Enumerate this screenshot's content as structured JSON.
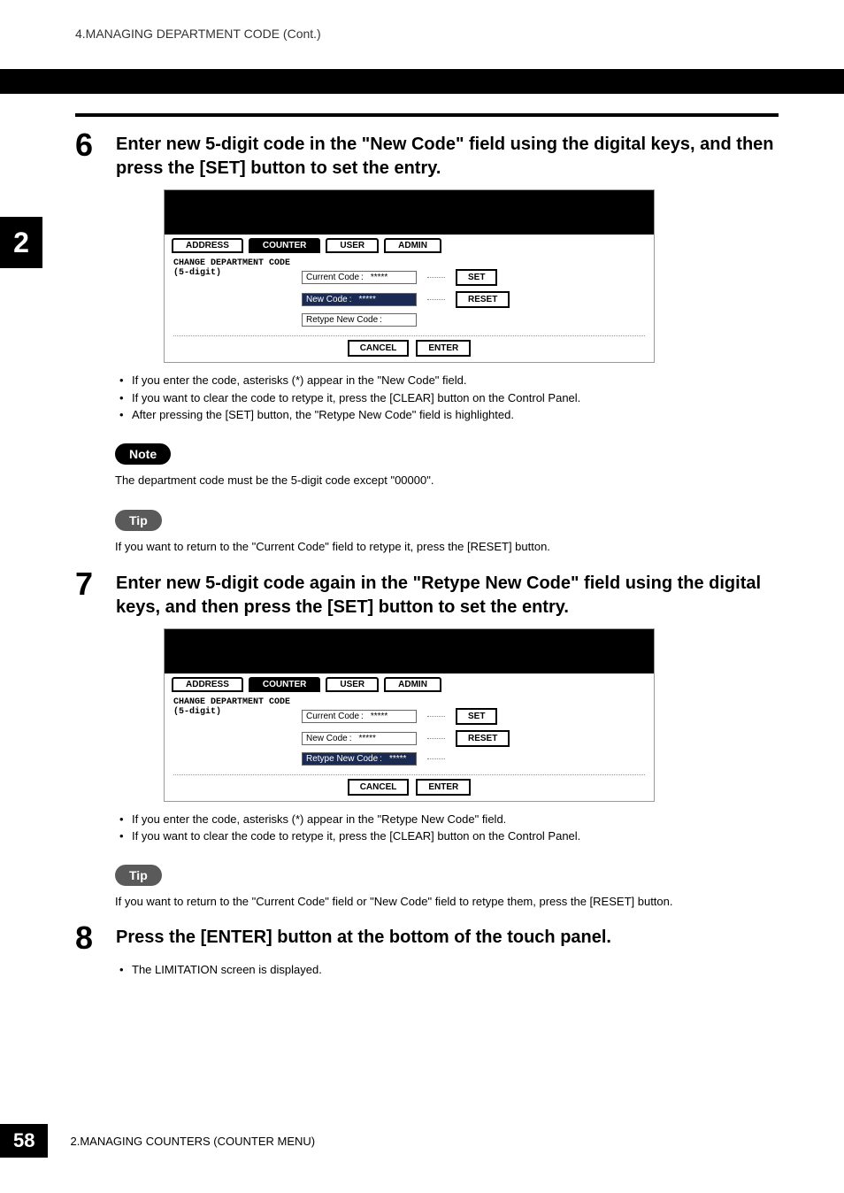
{
  "header": {
    "breadcrumb": "4.MANAGING DEPARTMENT CODE (Cont.)"
  },
  "chapterTab": "2",
  "step6": {
    "num": "6",
    "title": "Enter new 5-digit code in the \"New Code\" field using the digital keys, and then press the [SET] button to set the entry.",
    "bullets": [
      "If you enter the code, asterisks (*) appear in the \"New Code\" field.",
      "If you want to clear the code to retype it, press the [CLEAR] button on the Control Panel.",
      "After pressing the [SET] button, the \"Retype New Code\" field is highlighted."
    ]
  },
  "ui6": {
    "tabs": [
      "ADDRESS",
      "COUNTER",
      "USER",
      "ADMIN"
    ],
    "activeTab": 1,
    "title": "CHANGE DEPARTMENT CODE",
    "subtitle": "(5-digit)",
    "rows": {
      "current": {
        "label": "Current Code",
        "value": "*****",
        "btn": "SET"
      },
      "new": {
        "label": "New Code",
        "value": "*****",
        "btn": "RESET",
        "active": true
      },
      "retype": {
        "label": "Retype New Code",
        "value": "",
        "btn": null
      }
    },
    "bottom": {
      "cancel": "CANCEL",
      "enter": "ENTER"
    }
  },
  "note": {
    "label": "Note",
    "text": "The department code must be the 5-digit code except \"00000\"."
  },
  "tip6": {
    "label": "Tip",
    "text": "If you want to return to the \"Current Code\" field to retype it, press the [RESET] button."
  },
  "step7": {
    "num": "7",
    "title": "Enter new 5-digit code again in the \"Retype New Code\" field using the digital keys, and then press the [SET] button to set the entry.",
    "bullets": [
      "If you enter the code, asterisks (*) appear in the \"Retype New Code\" field.",
      "If you want to clear the code to retype it, press the [CLEAR] button on the Control Panel."
    ]
  },
  "ui7": {
    "tabs": [
      "ADDRESS",
      "COUNTER",
      "USER",
      "ADMIN"
    ],
    "activeTab": 1,
    "title": "CHANGE DEPARTMENT CODE",
    "subtitle": "(5-digit)",
    "rows": {
      "current": {
        "label": "Current Code",
        "value": "*****",
        "btn": "SET"
      },
      "new": {
        "label": "New Code",
        "value": "*****",
        "btn": "RESET"
      },
      "retype": {
        "label": "Retype New Code",
        "value": "*****",
        "btn": null,
        "active": true
      }
    },
    "bottom": {
      "cancel": "CANCEL",
      "enter": "ENTER"
    }
  },
  "tip7": {
    "label": "Tip",
    "text": "If you want to return to the \"Current Code\" field or \"New Code\" field to retype them, press the [RESET] button."
  },
  "step8": {
    "num": "8",
    "title": "Press the [ENTER] button at the bottom of the touch panel.",
    "bullets": [
      "The LIMITATION screen is displayed."
    ]
  },
  "footer": {
    "pageNum": "58",
    "text": "2.MANAGING COUNTERS (COUNTER MENU)"
  }
}
